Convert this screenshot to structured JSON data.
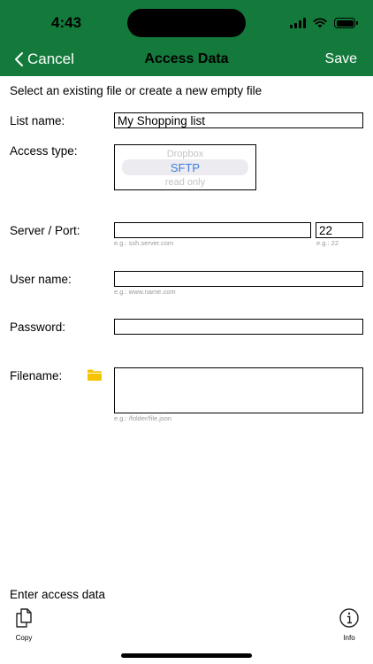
{
  "status_bar": {
    "time": "4:43"
  },
  "nav": {
    "cancel_label": "Cancel",
    "title": "Access Data",
    "save_label": "Save"
  },
  "instructions": "Select an existing file or create a new empty file",
  "form": {
    "list_name": {
      "label": "List name:",
      "value": "My Shopping list"
    },
    "access_type": {
      "label": "Access type:",
      "option_above": "Dropbox",
      "selected": "SFTP",
      "option_below": "read only"
    },
    "server": {
      "label": "Server / Port:",
      "value": "",
      "placeholder": "",
      "hint": "e.g.: ssh.server.com",
      "port_value": "22",
      "port_hint": "e.g.: 22"
    },
    "user_name": {
      "label": "User name:",
      "value": "",
      "hint": "e.g.: www.name.com"
    },
    "password": {
      "label": "Password:",
      "value": ""
    },
    "filename": {
      "label": "Filename:",
      "value": "",
      "hint": "e.g.: /folder/file.json"
    }
  },
  "bottom": {
    "status": "Enter access data"
  },
  "toolbar": {
    "copy_label": "Copy",
    "info_label": "Info"
  },
  "colors": {
    "header_bg": "#147a3c",
    "folder_icon": "#f5c400",
    "picker_selected": "#3d7bd8"
  }
}
